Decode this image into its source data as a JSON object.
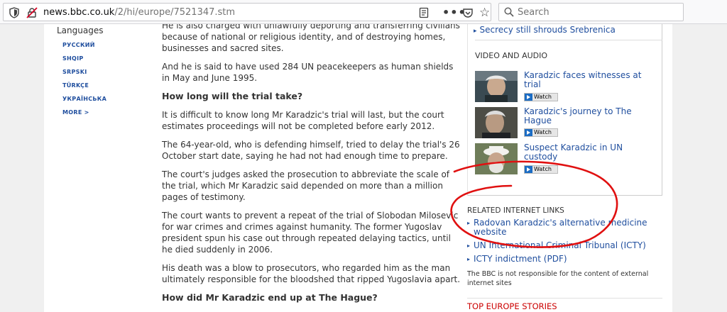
{
  "browser": {
    "url_host": "news.bbc.co.uk",
    "url_path": "/2/hi/europe/7521347.stm",
    "search_placeholder": "Search",
    "more_label": "•••"
  },
  "sidebar": {
    "title": "Languages",
    "items": [
      "РУССКИЙ",
      "SHQIP",
      "SRPSKI",
      "TÜRKÇE",
      "УКРАЇНСЬКА",
      "MORE >"
    ]
  },
  "article": {
    "p0": "He is also charged with unlawfully deporting and transferring civilians because of national or religious identity, and of destroying homes, businesses and sacred sites.",
    "p1": "And he is said to have used 284 UN peacekeepers as human shields in May and June 1995.",
    "h1": "How long will the trial take?",
    "p2": "It is difficult to know long Mr Karadzic's trial will last, but the court estimates proceedings will not be completed before early 2012.",
    "p3": "The 64-year-old, who is defending himself, tried to delay the trial's 26 October start date, saying he had not had enough time to prepare.",
    "p4": "The court's judges asked the prosecution to abbreviate the scale of the trial, which Mr Karadzic said depended on more than a million pages of testimony.",
    "p5": "The court wants to prevent a repeat of the trial of Slobodan Milosevic for war crimes and crimes against humanity. The former Yugoslav president spun his case out through repeated delaying tactics, until he died suddenly in 2006.",
    "p6": "His death was a blow to prosecutors, who regarded him as the man ultimately responsible for the bloodshed that ripped Yugoslavia apart.",
    "h2": "How did Mr Karadzic end up at The Hague?"
  },
  "right": {
    "top_link": "Secrecy still shrouds Srebrenica",
    "video_title": "VIDEO AND AUDIO",
    "videos": [
      {
        "title": "Karadzic faces witnesses at trial",
        "watch": "Watch"
      },
      {
        "title": "Karadzic's journey to The Hague",
        "watch": "Watch"
      },
      {
        "title": "Suspect Karadzic in UN custody",
        "watch": "Watch"
      }
    ],
    "related_title": "RELATED INTERNET LINKS",
    "links": [
      "Radovan Karadzic's alternative medicine website",
      "UN International Criminal Tribunal (ICTY)",
      "ICTY indictment (PDF)"
    ],
    "disclaimer": "The BBC is not responsible for the content of external internet sites",
    "top_stories": "TOP EUROPE STORIES"
  },
  "colors": {
    "link": "#1f4e9e",
    "annotation": "#e01010",
    "top_stories": "#cc0000"
  }
}
